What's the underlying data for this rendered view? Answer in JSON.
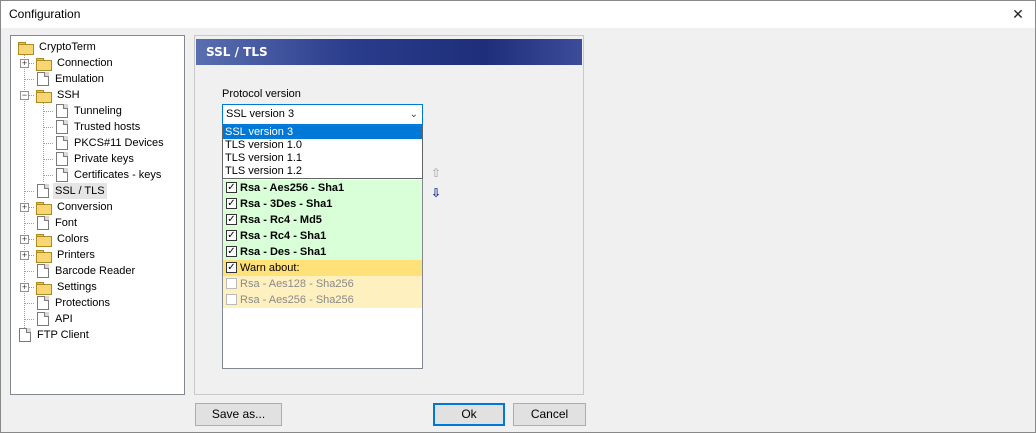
{
  "window": {
    "title": "Configuration",
    "close_glyph": "✕"
  },
  "tree": {
    "items": [
      {
        "label": "CryptoTerm",
        "icon": "folder-icon",
        "level": 0,
        "expander": ""
      },
      {
        "label": "Connection",
        "icon": "folder-icon",
        "level": 1,
        "expander": "+"
      },
      {
        "label": "Emulation",
        "icon": "page-icon",
        "level": 1,
        "expander": ""
      },
      {
        "label": "SSH",
        "icon": "folder-icon",
        "level": 1,
        "expander": "−"
      },
      {
        "label": "Tunneling",
        "icon": "page-icon",
        "level": 2,
        "expander": ""
      },
      {
        "label": "Trusted hosts",
        "icon": "page-icon",
        "level": 2,
        "expander": ""
      },
      {
        "label": "PKCS#11 Devices",
        "icon": "page-icon",
        "level": 2,
        "expander": ""
      },
      {
        "label": "Private keys",
        "icon": "page-icon",
        "level": 2,
        "expander": ""
      },
      {
        "label": "Certificates - keys",
        "icon": "page-icon",
        "level": 2,
        "expander": ""
      },
      {
        "label": "SSL / TLS",
        "icon": "page-icon",
        "level": 1,
        "expander": "",
        "selected": true
      },
      {
        "label": "Conversion",
        "icon": "folder-icon",
        "level": 1,
        "expander": "+"
      },
      {
        "label": "Font",
        "icon": "page-icon",
        "level": 1,
        "expander": ""
      },
      {
        "label": "Colors",
        "icon": "folder-icon",
        "level": 1,
        "expander": "+"
      },
      {
        "label": "Printers",
        "icon": "folder-icon",
        "level": 1,
        "expander": "+"
      },
      {
        "label": "Barcode Reader",
        "icon": "page-icon",
        "level": 1,
        "expander": ""
      },
      {
        "label": "Settings",
        "icon": "folder-icon",
        "level": 1,
        "expander": "+"
      },
      {
        "label": "Protections",
        "icon": "page-icon",
        "level": 1,
        "expander": ""
      },
      {
        "label": "API",
        "icon": "page-icon",
        "level": 1,
        "expander": ""
      },
      {
        "label": "FTP Client",
        "icon": "page-icon",
        "level": 0,
        "expander": ""
      }
    ]
  },
  "panel": {
    "title": "SSL / TLS",
    "protocol_label": "Protocol version",
    "protocol_selected": "SSL version 3",
    "protocol_options": [
      "SSL version 3",
      "TLS version 1.0",
      "TLS version 1.1",
      "TLS version 1.2"
    ],
    "ciphers": [
      {
        "label": "Rsa - Aes256 - Sha1",
        "checked": true,
        "kind": "ok"
      },
      {
        "label": "Rsa - 3Des - Sha1",
        "checked": true,
        "kind": "ok"
      },
      {
        "label": "Rsa - Rc4 - Md5",
        "checked": true,
        "kind": "ok"
      },
      {
        "label": "Rsa - Rc4 - Sha1",
        "checked": true,
        "kind": "ok"
      },
      {
        "label": "Rsa - Des - Sha1",
        "checked": true,
        "kind": "ok"
      },
      {
        "label": "Warn about:",
        "checked": true,
        "kind": "warn-h"
      },
      {
        "label": "Rsa - Aes128 - Sha256",
        "checked": false,
        "kind": "warn"
      },
      {
        "label": "Rsa - Aes256 - Sha256",
        "checked": false,
        "kind": "warn"
      }
    ],
    "move_up_glyph": "⇧",
    "move_down_glyph": "⇩"
  },
  "buttons": {
    "save_as": "Save as...",
    "ok": "Ok",
    "cancel": "Cancel"
  }
}
